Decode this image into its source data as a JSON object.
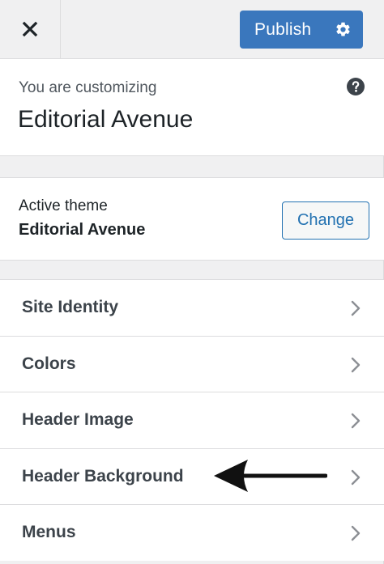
{
  "header": {
    "close_icon": "close-icon",
    "publish_label": "Publish",
    "settings_icon": "gear-icon"
  },
  "customizing": {
    "label": "You are customizing",
    "site_name": "Editorial Avenue",
    "help_icon": "question-circle-icon"
  },
  "active_theme": {
    "label": "Active theme",
    "name": "Editorial Avenue",
    "change_label": "Change"
  },
  "sections": [
    {
      "label": "Site Identity"
    },
    {
      "label": "Colors"
    },
    {
      "label": "Header Image"
    },
    {
      "label": "Header Background"
    },
    {
      "label": "Menus"
    }
  ],
  "colors": {
    "accent": "#3a77bd",
    "link": "#2271b1",
    "panel_bg": "#f0f0f1",
    "card_bg": "#ffffff"
  }
}
